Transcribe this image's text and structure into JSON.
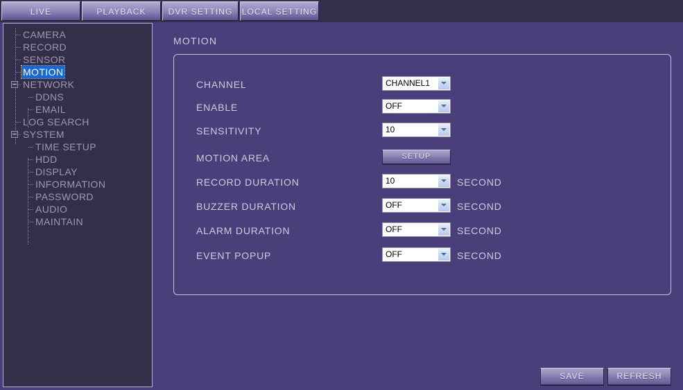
{
  "tabs": [
    {
      "id": "live",
      "label": "LIVE"
    },
    {
      "id": "playback",
      "label": "PLAYBACK"
    },
    {
      "id": "dvr-setting",
      "label": "DVR SETTING"
    },
    {
      "id": "local-setting",
      "label": "LOCAL SETTING"
    }
  ],
  "sidebar": {
    "items": [
      {
        "label": "CAMERA",
        "level": 1,
        "expander": false,
        "selected": false
      },
      {
        "label": "RECORD",
        "level": 1,
        "expander": false,
        "selected": false
      },
      {
        "label": "SENSOR",
        "level": 1,
        "expander": false,
        "selected": false
      },
      {
        "label": "MOTION",
        "level": 1,
        "expander": false,
        "selected": true
      },
      {
        "label": "NETWORK",
        "level": 1,
        "expander": true,
        "selected": false
      },
      {
        "label": "DDNS",
        "level": 2,
        "expander": false,
        "selected": false
      },
      {
        "label": "EMAIL",
        "level": 2,
        "expander": false,
        "selected": false
      },
      {
        "label": "LOG SEARCH",
        "level": 1,
        "expander": false,
        "selected": false
      },
      {
        "label": "SYSTEM",
        "level": 1,
        "expander": true,
        "selected": false
      },
      {
        "label": "TIME SETUP",
        "level": 2,
        "expander": false,
        "selected": false
      },
      {
        "label": "HDD",
        "level": 2,
        "expander": false,
        "selected": false
      },
      {
        "label": "DISPLAY",
        "level": 2,
        "expander": false,
        "selected": false
      },
      {
        "label": "INFORMATION",
        "level": 2,
        "expander": false,
        "selected": false
      },
      {
        "label": "PASSWORD",
        "level": 2,
        "expander": false,
        "selected": false
      },
      {
        "label": "AUDIO",
        "level": 2,
        "expander": false,
        "selected": false
      },
      {
        "label": "MAINTAIN",
        "level": 2,
        "expander": false,
        "selected": false
      }
    ]
  },
  "main": {
    "title": "MOTION",
    "rows": [
      {
        "label": "CHANNEL",
        "control": "select",
        "value": "CHANNEL1",
        "suffix": ""
      },
      {
        "label": "ENABLE",
        "control": "select",
        "value": "OFF",
        "suffix": ""
      },
      {
        "label": "SENSITIVITY",
        "control": "select",
        "value": "10",
        "suffix": ""
      },
      {
        "label": "MOTION AREA",
        "control": "button",
        "value": "SETUP",
        "suffix": ""
      },
      {
        "label": "RECORD DURATION",
        "control": "select",
        "value": "10",
        "suffix": "SECOND"
      },
      {
        "label": "BUZZER DURATION",
        "control": "select",
        "value": "OFF",
        "suffix": "SECOND"
      },
      {
        "label": "ALARM DURATION",
        "control": "select",
        "value": "OFF",
        "suffix": "SECOND"
      },
      {
        "label": "EVENT POPUP",
        "control": "select",
        "value": "OFF",
        "suffix": "SECOND"
      }
    ]
  },
  "footer": {
    "save_label": "SAVE",
    "refresh_label": "REFRESH"
  },
  "colors": {
    "background": "#4a3f7a",
    "tabbar": "#322f4a",
    "sidebar": "#332f4a",
    "selection": "#1569d8",
    "text": "#cfccdf"
  }
}
